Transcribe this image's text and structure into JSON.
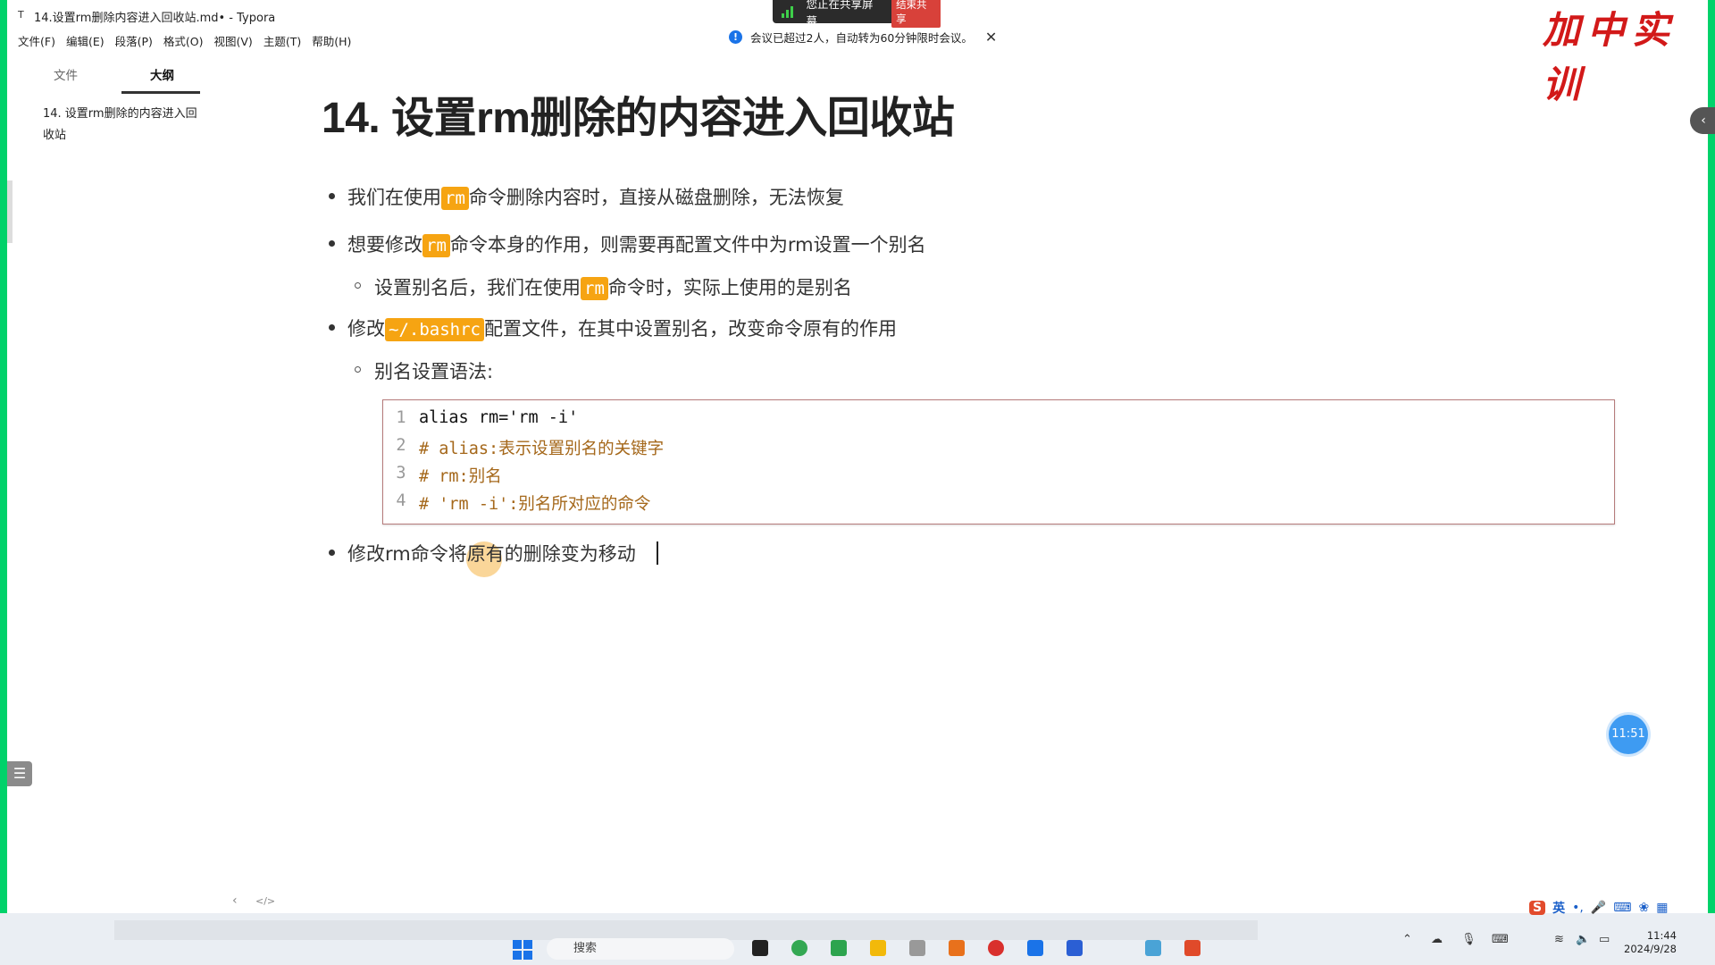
{
  "window": {
    "title": "14.设置rm删除内容进入回收站.md• - Typora"
  },
  "menu": [
    "文件(F)",
    "编辑(E)",
    "段落(P)",
    "格式(O)",
    "视图(V)",
    "主题(T)",
    "帮助(H)"
  ],
  "share_bar": {
    "status": "您正在共享屏幕",
    "end_button": "结束共享"
  },
  "notice": {
    "text": "会议已超过2人，自动转为60分钟限时会议。"
  },
  "watermark": "加中实训",
  "sidebar": {
    "tab_files": "文件",
    "tab_outline": "大纲",
    "outline_items": [
      "14. 设置rm删除的内容进入回收站"
    ]
  },
  "document": {
    "title": "14. 设置rm删除的内容进入回收站",
    "b1_pre": "我们在使用",
    "b1_code": "rm",
    "b1_post": "命令删除内容时，直接从磁盘删除，无法恢复",
    "b2_pre": "想要修改",
    "b2_code": "rm",
    "b2_post": "命令本身的作用，则需要再配置文件中为rm设置一个别名",
    "b2s_pre": "设置别名后，我们在使用",
    "b2s_code": "rm",
    "b2s_post": "命令时，实际上使用的是别名",
    "b3_pre": "修改",
    "b3_code": "~/.bashrc",
    "b3_post": "配置文件，在其中设置别名，改变命令原有的作用",
    "b3s": "别名设置语法:",
    "b4": "修改rm命令将原有的删除变为移动"
  },
  "code_block": {
    "lines": [
      {
        "num": "1",
        "text": "alias rm='rm -i'"
      },
      {
        "num": "2",
        "text": "# alias:表示设置别名的关键字"
      },
      {
        "num": "3",
        "text": "# rm:别名"
      },
      {
        "num": "4",
        "text": "# 'rm -i':别名所对应的命令"
      }
    ]
  },
  "timer_badge": "11:51",
  "taskbar": {
    "search_placeholder": "搜索",
    "time": "11:44",
    "date": "2024/9/28",
    "ime_lang": "英"
  },
  "colors": {
    "inline_code_bg": "#f6a412",
    "comment": "#a5681b",
    "watermark": "#d21919",
    "screen_border": "#00d26a"
  }
}
